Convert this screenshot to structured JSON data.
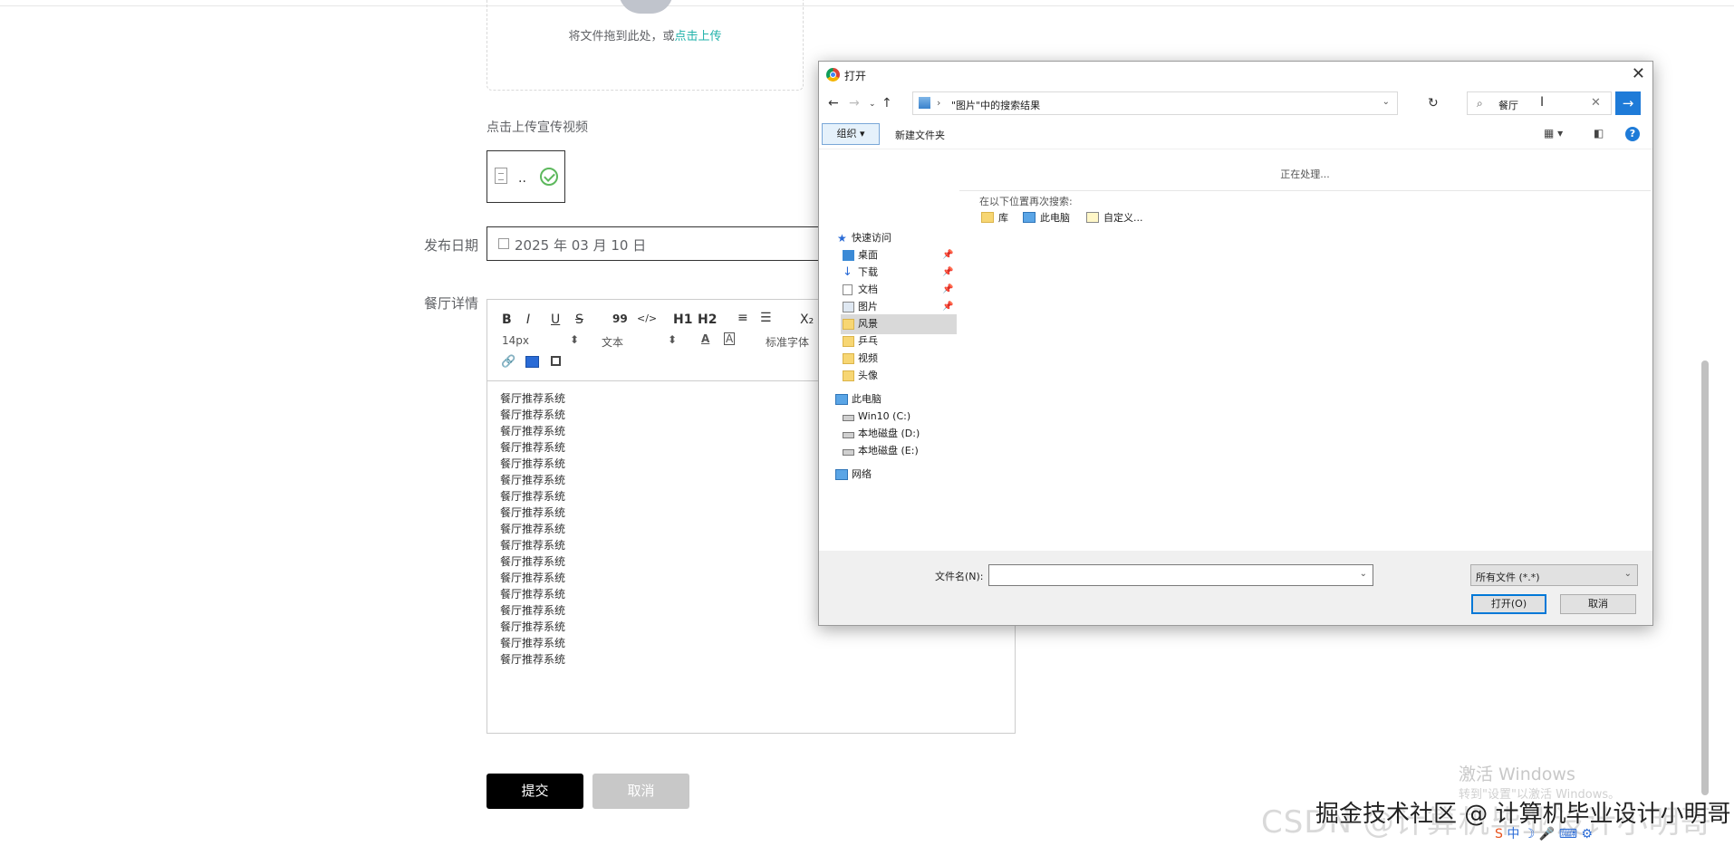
{
  "form": {
    "upload_tip": "将文件拖到此处，或",
    "upload_link": "点击上传",
    "video_label": "点击上传宣传视频",
    "video_file_dots": "..",
    "date_label": "发布日期",
    "date_value": "2025 年 03 月 10 日",
    "detail_label": "餐厅详情",
    "submit_label": "提交",
    "cancel_label": "取消"
  },
  "editor": {
    "toolbar_row1": [
      "B",
      "I",
      "U",
      "S",
      "99",
      "</>",
      "H1",
      "H2",
      "≡",
      "☰",
      "X₂"
    ],
    "font_size": "14px",
    "paragraph": "文本",
    "font_family": "标准字体",
    "lines": [
      "餐厅推荐系统",
      "餐厅推荐系统",
      "餐厅推荐系统",
      "餐厅推荐系统",
      "餐厅推荐系统",
      "餐厅推荐系统",
      "餐厅推荐系统",
      "餐厅推荐系统",
      "餐厅推荐系统",
      "餐厅推荐系统",
      "餐厅推荐系统",
      "餐厅推荐系统",
      "餐厅推荐系统",
      "餐厅推荐系统",
      "餐厅推荐系统",
      "餐厅推荐系统",
      "餐厅推荐系统"
    ]
  },
  "dialog": {
    "title": "打开",
    "address_path": "\"图片\"中的搜索结果",
    "search_query": "餐厅",
    "organize_label": "组织 ▾",
    "new_folder_label": "新建文件夹",
    "processing_text": "正在处理...",
    "search_again_text": "在以下位置再次搜索:",
    "search_locations": [
      "库",
      "此电脑",
      "自定义..."
    ],
    "nav": {
      "quick_access": "快速访问",
      "quick_items": [
        "桌面",
        "下载",
        "文档",
        "图片"
      ],
      "folders": [
        "风景",
        "乒乓",
        "视频",
        "头像"
      ],
      "this_pc": "此电脑",
      "drives": [
        "Win10 (C:)",
        "本地磁盘 (D:)",
        "本地磁盘 (E:)"
      ],
      "network": "网络"
    },
    "filename_label": "文件名(N):",
    "filename_value": "",
    "filetype_value": "所有文件 (*.*)",
    "open_label": "打开(O)",
    "cancel_label": "取消"
  },
  "watermarks": {
    "activate_title": "激活 Windows",
    "activate_sub": "转到\"设置\"以激活 Windows。",
    "csdn": "CSDN @计算机毕业设计小明哥",
    "juejin": "掘金技术社区 @ 计算机毕业设计小明哥"
  }
}
